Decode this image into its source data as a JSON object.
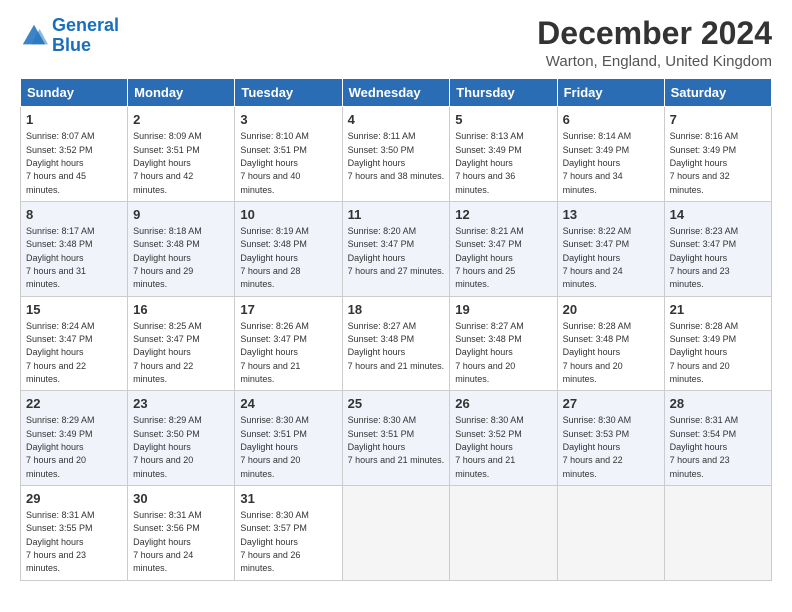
{
  "logo": {
    "line1": "General",
    "line2": "Blue"
  },
  "title": "December 2024",
  "location": "Warton, England, United Kingdom",
  "days_of_week": [
    "Sunday",
    "Monday",
    "Tuesday",
    "Wednesday",
    "Thursday",
    "Friday",
    "Saturday"
  ],
  "weeks": [
    [
      {
        "day": "1",
        "sunrise": "8:07 AM",
        "sunset": "3:52 PM",
        "daylight": "7 hours and 45 minutes."
      },
      {
        "day": "2",
        "sunrise": "8:09 AM",
        "sunset": "3:51 PM",
        "daylight": "7 hours and 42 minutes."
      },
      {
        "day": "3",
        "sunrise": "8:10 AM",
        "sunset": "3:51 PM",
        "daylight": "7 hours and 40 minutes."
      },
      {
        "day": "4",
        "sunrise": "8:11 AM",
        "sunset": "3:50 PM",
        "daylight": "7 hours and 38 minutes."
      },
      {
        "day": "5",
        "sunrise": "8:13 AM",
        "sunset": "3:49 PM",
        "daylight": "7 hours and 36 minutes."
      },
      {
        "day": "6",
        "sunrise": "8:14 AM",
        "sunset": "3:49 PM",
        "daylight": "7 hours and 34 minutes."
      },
      {
        "day": "7",
        "sunrise": "8:16 AM",
        "sunset": "3:49 PM",
        "daylight": "7 hours and 32 minutes."
      }
    ],
    [
      {
        "day": "8",
        "sunrise": "8:17 AM",
        "sunset": "3:48 PM",
        "daylight": "7 hours and 31 minutes."
      },
      {
        "day": "9",
        "sunrise": "8:18 AM",
        "sunset": "3:48 PM",
        "daylight": "7 hours and 29 minutes."
      },
      {
        "day": "10",
        "sunrise": "8:19 AM",
        "sunset": "3:48 PM",
        "daylight": "7 hours and 28 minutes."
      },
      {
        "day": "11",
        "sunrise": "8:20 AM",
        "sunset": "3:47 PM",
        "daylight": "7 hours and 27 minutes."
      },
      {
        "day": "12",
        "sunrise": "8:21 AM",
        "sunset": "3:47 PM",
        "daylight": "7 hours and 25 minutes."
      },
      {
        "day": "13",
        "sunrise": "8:22 AM",
        "sunset": "3:47 PM",
        "daylight": "7 hours and 24 minutes."
      },
      {
        "day": "14",
        "sunrise": "8:23 AM",
        "sunset": "3:47 PM",
        "daylight": "7 hours and 23 minutes."
      }
    ],
    [
      {
        "day": "15",
        "sunrise": "8:24 AM",
        "sunset": "3:47 PM",
        "daylight": "7 hours and 22 minutes."
      },
      {
        "day": "16",
        "sunrise": "8:25 AM",
        "sunset": "3:47 PM",
        "daylight": "7 hours and 22 minutes."
      },
      {
        "day": "17",
        "sunrise": "8:26 AM",
        "sunset": "3:47 PM",
        "daylight": "7 hours and 21 minutes."
      },
      {
        "day": "18",
        "sunrise": "8:27 AM",
        "sunset": "3:48 PM",
        "daylight": "7 hours and 21 minutes."
      },
      {
        "day": "19",
        "sunrise": "8:27 AM",
        "sunset": "3:48 PM",
        "daylight": "7 hours and 20 minutes."
      },
      {
        "day": "20",
        "sunrise": "8:28 AM",
        "sunset": "3:48 PM",
        "daylight": "7 hours and 20 minutes."
      },
      {
        "day": "21",
        "sunrise": "8:28 AM",
        "sunset": "3:49 PM",
        "daylight": "7 hours and 20 minutes."
      }
    ],
    [
      {
        "day": "22",
        "sunrise": "8:29 AM",
        "sunset": "3:49 PM",
        "daylight": "7 hours and 20 minutes."
      },
      {
        "day": "23",
        "sunrise": "8:29 AM",
        "sunset": "3:50 PM",
        "daylight": "7 hours and 20 minutes."
      },
      {
        "day": "24",
        "sunrise": "8:30 AM",
        "sunset": "3:51 PM",
        "daylight": "7 hours and 20 minutes."
      },
      {
        "day": "25",
        "sunrise": "8:30 AM",
        "sunset": "3:51 PM",
        "daylight": "7 hours and 21 minutes."
      },
      {
        "day": "26",
        "sunrise": "8:30 AM",
        "sunset": "3:52 PM",
        "daylight": "7 hours and 21 minutes."
      },
      {
        "day": "27",
        "sunrise": "8:30 AM",
        "sunset": "3:53 PM",
        "daylight": "7 hours and 22 minutes."
      },
      {
        "day": "28",
        "sunrise": "8:31 AM",
        "sunset": "3:54 PM",
        "daylight": "7 hours and 23 minutes."
      }
    ],
    [
      {
        "day": "29",
        "sunrise": "8:31 AM",
        "sunset": "3:55 PM",
        "daylight": "7 hours and 23 minutes."
      },
      {
        "day": "30",
        "sunrise": "8:31 AM",
        "sunset": "3:56 PM",
        "daylight": "7 hours and 24 minutes."
      },
      {
        "day": "31",
        "sunrise": "8:30 AM",
        "sunset": "3:57 PM",
        "daylight": "7 hours and 26 minutes."
      },
      null,
      null,
      null,
      null
    ]
  ]
}
